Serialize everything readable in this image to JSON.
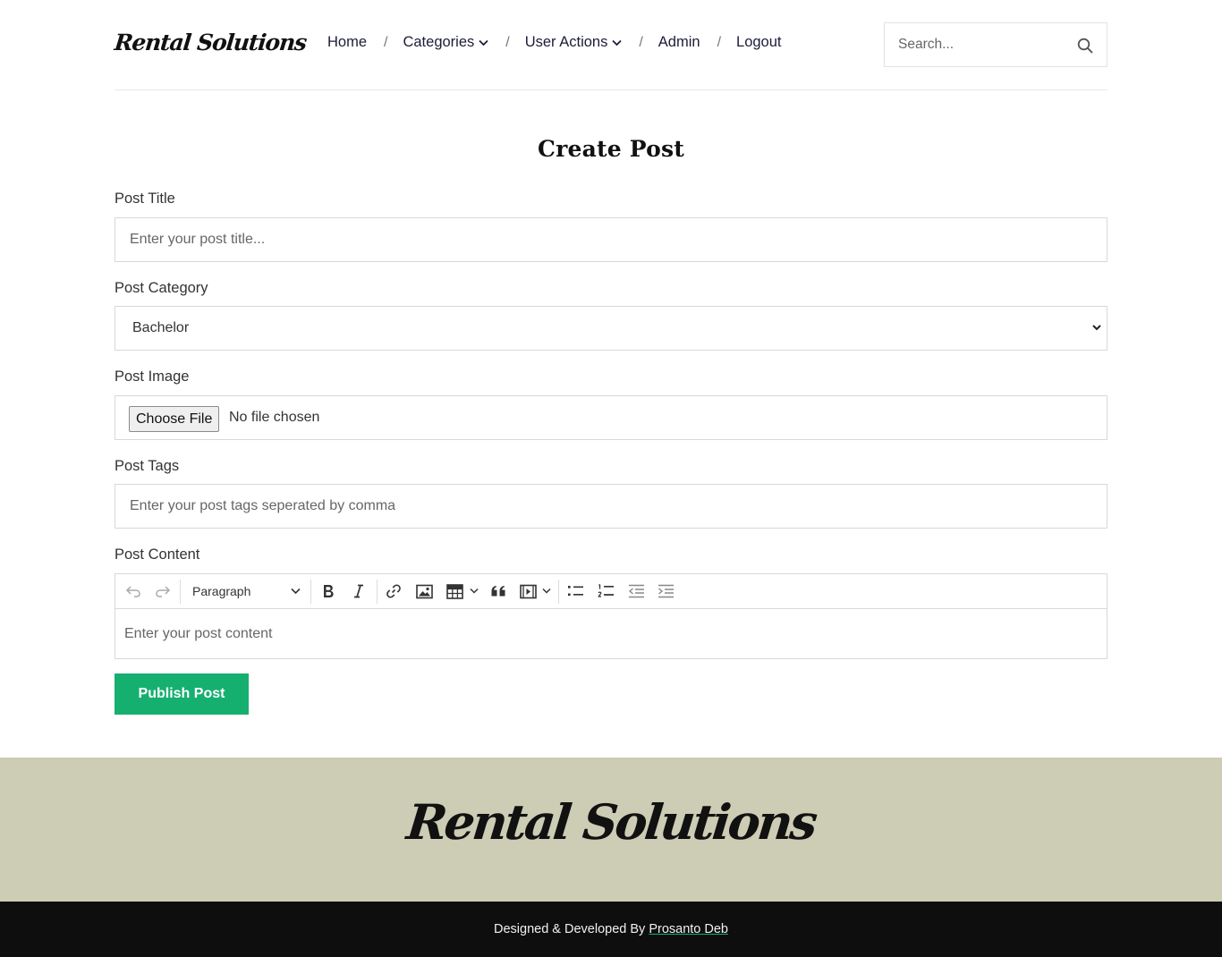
{
  "brand": {
    "logo": "Rental Solutions"
  },
  "nav": {
    "items": [
      {
        "label": "Home",
        "dropdown": false
      },
      {
        "label": "Categories",
        "dropdown": true
      },
      {
        "label": "User Actions",
        "dropdown": true
      },
      {
        "label": "Admin",
        "dropdown": false
      },
      {
        "label": "Logout",
        "dropdown": false
      }
    ],
    "separator": "/"
  },
  "search": {
    "placeholder": "Search...",
    "icon": "search-icon"
  },
  "page": {
    "title": "Create Post"
  },
  "form": {
    "title_label": "Post Title",
    "title_placeholder": "Enter your post title...",
    "category_label": "Post Category",
    "category_selected": "Bachelor",
    "image_label": "Post Image",
    "file_button": "Choose File",
    "file_status": "No file chosen",
    "tags_label": "Post Tags",
    "tags_placeholder": "Enter your post tags seperated by comma",
    "content_label": "Post Content",
    "content_placeholder": "Enter your post content",
    "submit_label": "Publish Post"
  },
  "editor": {
    "heading_select": "Paragraph",
    "tools": [
      "undo-icon",
      "redo-icon",
      "bold-icon",
      "italic-icon",
      "link-icon",
      "image-icon",
      "table-icon",
      "blockquote-icon",
      "media-icon",
      "bulleted-list-icon",
      "numbered-list-icon",
      "outdent-icon",
      "indent-icon"
    ]
  },
  "footer": {
    "logo": "Rental Solutions",
    "credit_text": "Designed & Developed By",
    "credit_link": "Prosanto Deb"
  },
  "colors": {
    "accent": "#15b06f",
    "footer_band": "#cdccb4",
    "footer_bar": "#0e0e0e",
    "nav_text": "#1c1c3a"
  }
}
